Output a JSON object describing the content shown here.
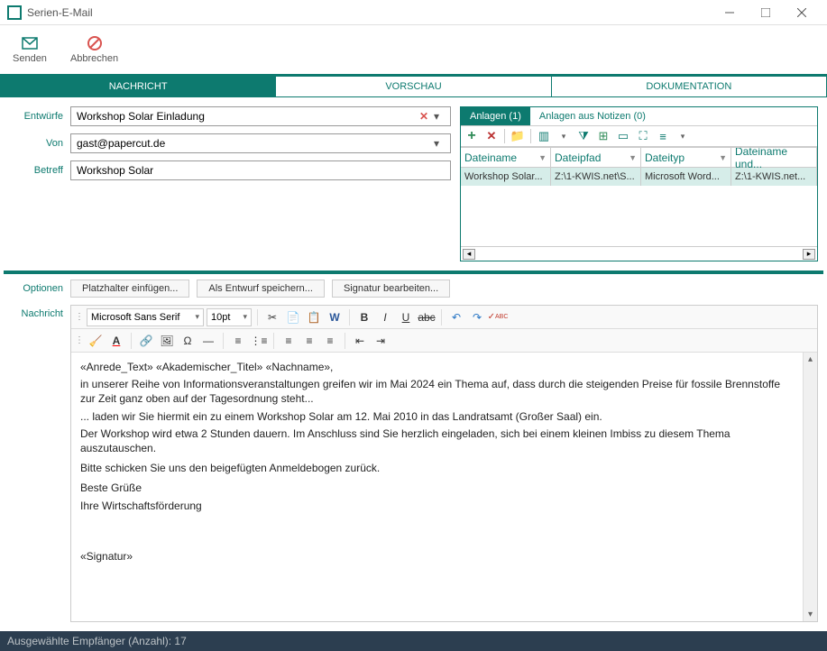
{
  "window": {
    "title": "Serien-E-Mail"
  },
  "toolbar": {
    "send": "Senden",
    "cancel": "Abbrechen"
  },
  "tabs": {
    "message": "NACHRICHT",
    "preview": "VORSCHAU",
    "docs": "DOKUMENTATION"
  },
  "form": {
    "drafts_label": "Entwürfe",
    "drafts_value": "Workshop Solar Einladung",
    "from_label": "Von",
    "from_value": "gast@papercut.de",
    "subject_label": "Betreff",
    "subject_value": "Workshop Solar"
  },
  "attachments": {
    "tab_files": "Anlagen (1)",
    "tab_notes": "Anlagen aus Notizen (0)",
    "cols": {
      "name": "Dateiname",
      "path": "Dateipfad",
      "type": "Dateityp",
      "name2": "Dateiname und..."
    },
    "row": {
      "name": "Workshop Solar...",
      "path": "Z:\\1-KWIS.net\\S...",
      "type": "Microsoft Word...",
      "name2": "Z:\\1-KWIS.net..."
    }
  },
  "options": {
    "label": "Optionen",
    "insert_placeholder": "Platzhalter einfügen...",
    "save_draft": "Als Entwurf speichern...",
    "edit_signature": "Signatur bearbeiten..."
  },
  "editor": {
    "label": "Nachricht",
    "font_name": "Microsoft Sans Serif",
    "font_size": "10pt",
    "body_line1": "«Anrede_Text» «Akademischer_Titel» «Nachname»,",
    "body_line2": "in unserer Reihe von Informationsveranstaltungen greifen wir im Mai 2024 ein Thema auf, dass durch die steigenden Preise für fossile Brennstoffe zur Zeit ganz oben auf der Tagesordnung steht...",
    "body_line3": "... laden wir Sie hiermit ein zu einem Workshop Solar am 12. Mai 2010 in das Landratsamt (Großer Saal) ein.",
    "body_line4": "Der Workshop wird etwa 2 Stunden dauern. Im Anschluss sind Sie herzlich eingeladen, sich bei einem kleinen Imbiss zu diesem Thema auszutauschen.",
    "body_line5": "Bitte schicken Sie uns den beigefügten Anmeldebogen zurück.",
    "body_line6": "Beste Grüße",
    "body_line7": "Ihre Wirtschaftsförderung",
    "body_line8": "«Signatur»"
  },
  "status": {
    "recipients": "Ausgewählte Empfänger (Anzahl): 17"
  }
}
